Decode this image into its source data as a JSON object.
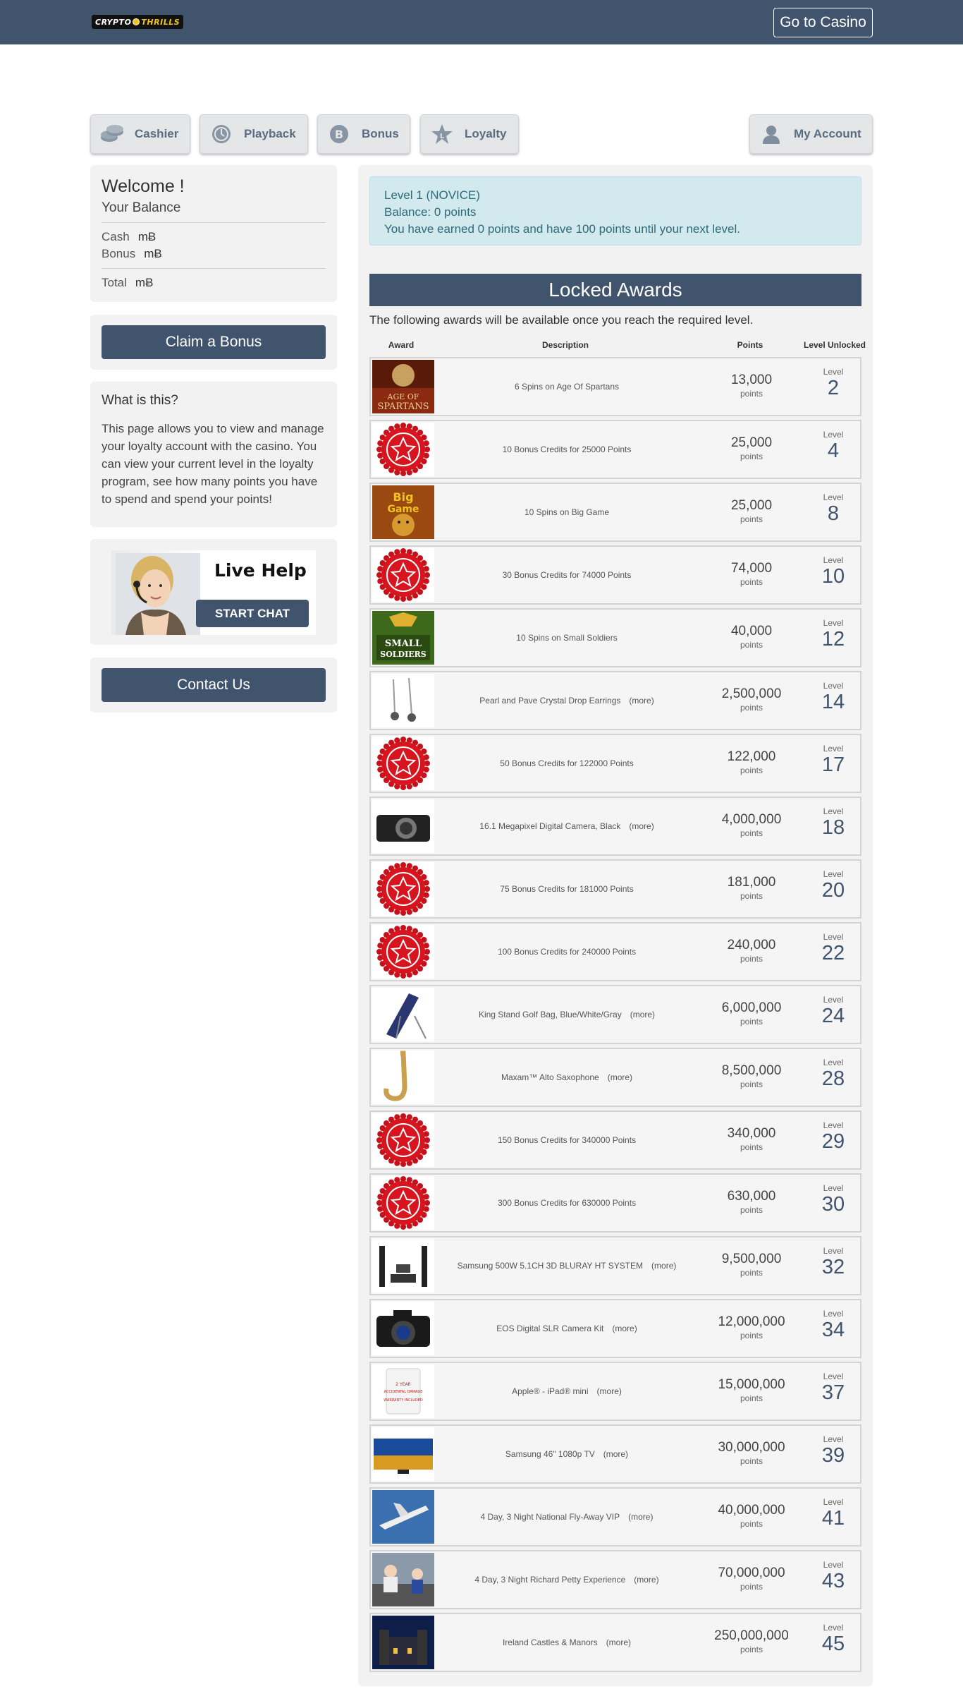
{
  "header": {
    "logo_left": "CRYPTO",
    "logo_right": "THRILLS",
    "go_casino": "Go to Casino"
  },
  "nav": {
    "cashier": "Cashier",
    "playback": "Playback",
    "bonus": "Bonus",
    "loyalty": "Loyalty",
    "account": "My Account"
  },
  "welcome": {
    "title": "Welcome !",
    "balance_label": "Your Balance",
    "cash_label": "Cash",
    "cash_value": "mɃ",
    "bonus_label": "Bonus",
    "bonus_value": "mɃ",
    "total_label": "Total",
    "total_value": "mɃ"
  },
  "claim_bonus": "Claim a Bonus",
  "what": {
    "title": "What is this?",
    "text": "This page allows you to view and manage your loyalty account with the casino. You can view your current level in the loyalty program, see how many points you have to spend and spend your points!"
  },
  "livehelp": {
    "title": "Live Help",
    "button": "START CHAT"
  },
  "contact": "Contact Us",
  "level_info": {
    "line1": "Level 1 (NOVICE)",
    "line2": "Balance: 0 points",
    "line3": "You have earned 0 points and have 100 points until your next level."
  },
  "locked": {
    "title": "Locked Awards",
    "subtitle": "The following awards will be available once you reach the required level.",
    "col_award": "Award",
    "col_desc": "Description",
    "col_points": "Points",
    "col_level": "Level Unlocked",
    "points_unit": "points",
    "level_word": "Level",
    "more": "(more)",
    "rows": [
      {
        "desc": "6 Spins on Age Of Spartans",
        "points": "13,000",
        "level": "2",
        "more": false,
        "img": "spartans"
      },
      {
        "desc": "10 Bonus Credits for 25000 Points",
        "points": "25,000",
        "level": "4",
        "more": false,
        "img": "chip"
      },
      {
        "desc": "10 Spins on Big Game",
        "points": "25,000",
        "level": "8",
        "more": false,
        "img": "biggame"
      },
      {
        "desc": "30 Bonus Credits for 74000 Points",
        "points": "74,000",
        "level": "10",
        "more": false,
        "img": "chip"
      },
      {
        "desc": "10 Spins on Small Soldiers",
        "points": "40,000",
        "level": "12",
        "more": false,
        "img": "soldiers"
      },
      {
        "desc": "Pearl and Pave Crystal Drop Earrings",
        "points": "2,500,000",
        "level": "14",
        "more": true,
        "img": "earrings"
      },
      {
        "desc": "50 Bonus Credits for 122000 Points",
        "points": "122,000",
        "level": "17",
        "more": false,
        "img": "chip"
      },
      {
        "desc": "16.1 Megapixel Digital Camera, Black",
        "points": "4,000,000",
        "level": "18",
        "more": true,
        "img": "camera"
      },
      {
        "desc": "75 Bonus Credits for 181000 Points",
        "points": "181,000",
        "level": "20",
        "more": false,
        "img": "chip"
      },
      {
        "desc": "100 Bonus Credits for 240000 Points",
        "points": "240,000",
        "level": "22",
        "more": false,
        "img": "chip"
      },
      {
        "desc": "King Stand Golf Bag, Blue/White/Gray",
        "points": "6,000,000",
        "level": "24",
        "more": true,
        "img": "golf"
      },
      {
        "desc": "Maxam™ Alto Saxophone",
        "points": "8,500,000",
        "level": "28",
        "more": true,
        "img": "sax"
      },
      {
        "desc": "150 Bonus Credits for 340000 Points",
        "points": "340,000",
        "level": "29",
        "more": false,
        "img": "chip"
      },
      {
        "desc": "300 Bonus Credits for 630000 Points",
        "points": "630,000",
        "level": "30",
        "more": false,
        "img": "chip"
      },
      {
        "desc": "Samsung 500W 5.1CH 3D BLURAY HT SYSTEM",
        "points": "9,500,000",
        "level": "32",
        "more": true,
        "img": "speakers"
      },
      {
        "desc": "EOS Digital SLR Camera Kit",
        "points": "12,000,000",
        "level": "34",
        "more": true,
        "img": "dslr"
      },
      {
        "desc": "Apple® - iPad® mini",
        "points": "15,000,000",
        "level": "37",
        "more": true,
        "img": "ipad"
      },
      {
        "desc": "Samsung 46\" 1080p TV",
        "points": "30,000,000",
        "level": "39",
        "more": true,
        "img": "tv"
      },
      {
        "desc": "4 Day, 3 Night National Fly-Away VIP",
        "points": "40,000,000",
        "level": "41",
        "more": true,
        "img": "plane"
      },
      {
        "desc": "4 Day, 3 Night Richard Petty Experience",
        "points": "70,000,000",
        "level": "43",
        "more": true,
        "img": "racing"
      },
      {
        "desc": "Ireland Castles & Manors",
        "points": "250,000,000",
        "level": "45",
        "more": true,
        "img": "castle"
      }
    ]
  }
}
